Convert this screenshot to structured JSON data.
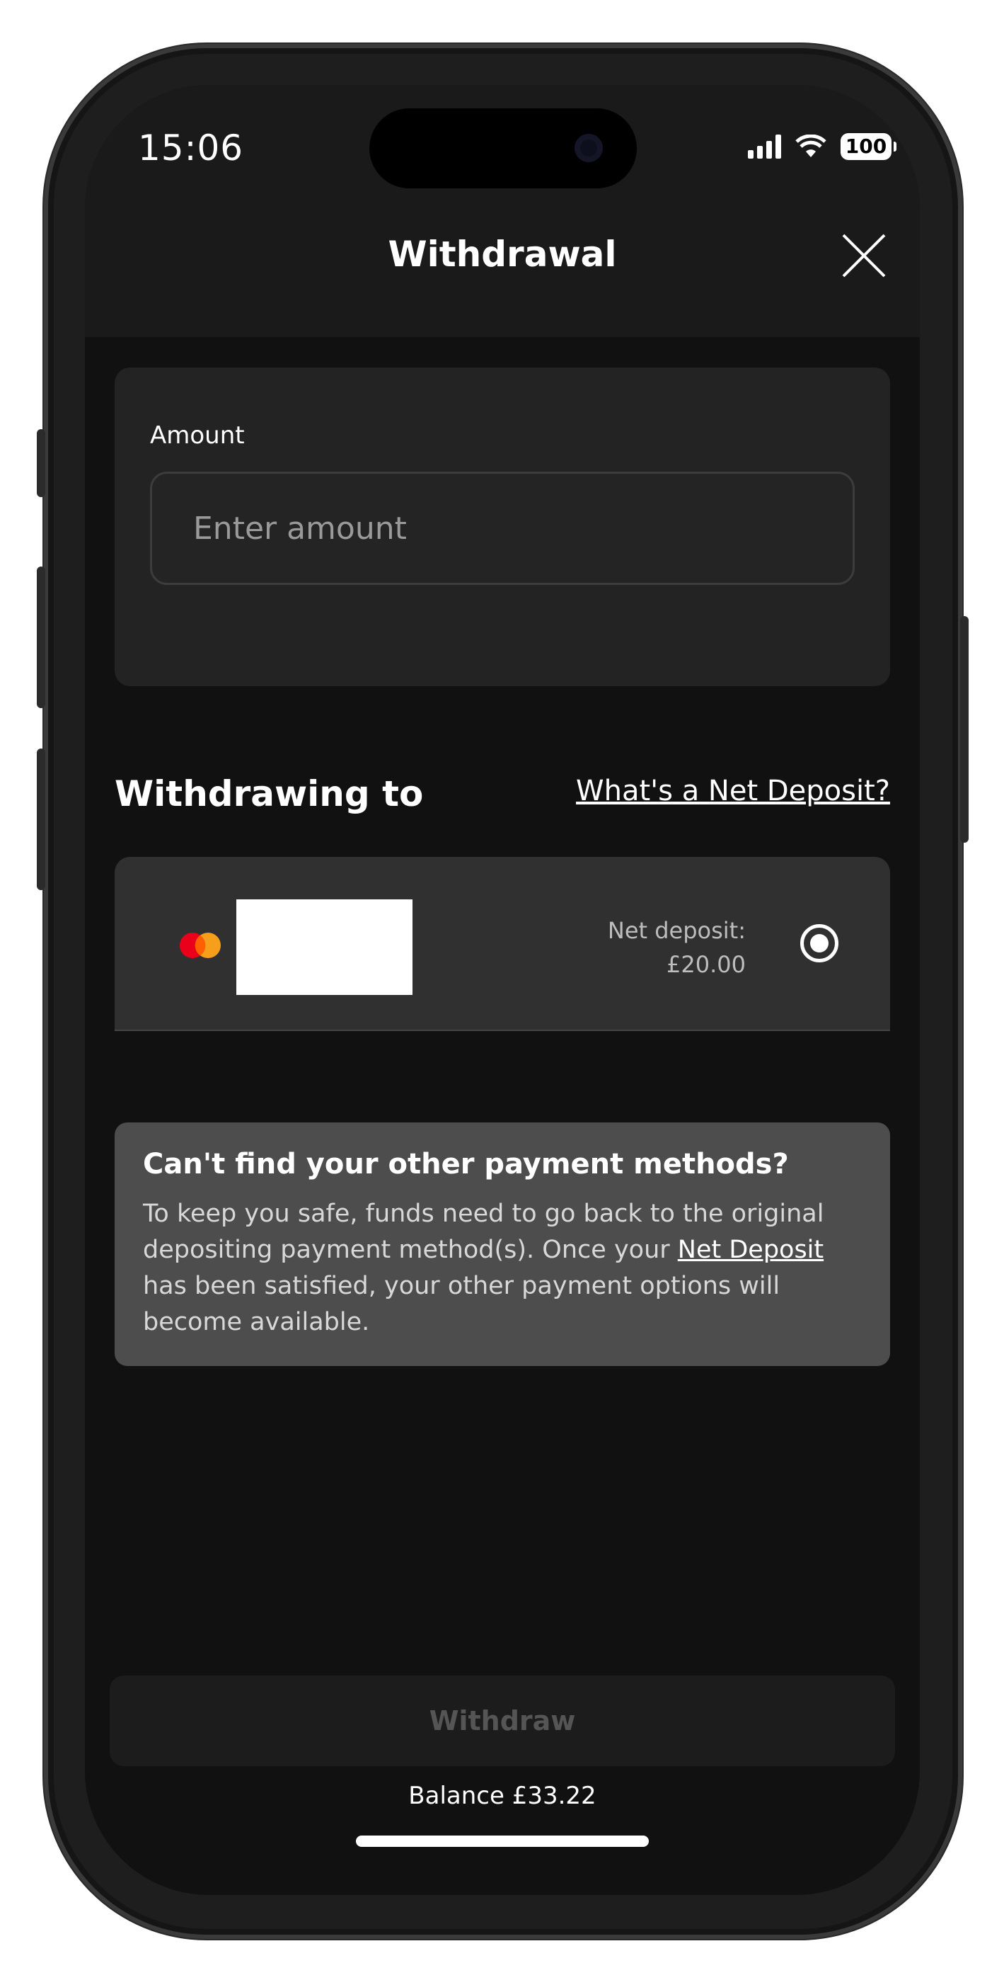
{
  "status_bar": {
    "time": "15:06",
    "battery": "100",
    "icons": [
      "signal-icon",
      "wifi-icon",
      "battery-icon"
    ]
  },
  "header": {
    "title": "Withdrawal",
    "close_icon": "close-icon"
  },
  "amount": {
    "label": "Amount",
    "placeholder": "Enter amount",
    "value": ""
  },
  "withdrawing_to": {
    "title": "Withdrawing to",
    "net_deposit_link": "What's a Net Deposit?",
    "methods": [
      {
        "brand_icon": "mastercard-icon",
        "net_deposit_label": "Net deposit:",
        "net_deposit_value": "£20.00",
        "selected": true
      }
    ]
  },
  "info": {
    "title": "Can't find your other payment methods?",
    "text_before": "To keep you safe, funds need to go back to the original depositing payment method(s). Once your ",
    "link": "Net Deposit",
    "text_after": " has been satisfied, your other payment options will become available."
  },
  "footer": {
    "withdraw_label": "Withdraw",
    "balance": "Balance £33.22"
  },
  "colors": {
    "background": "#111111",
    "card": "#232323",
    "method_card": "#303030",
    "info_box": "#4d4d4d",
    "text": "#ffffff",
    "disabled_text": "#555555"
  }
}
